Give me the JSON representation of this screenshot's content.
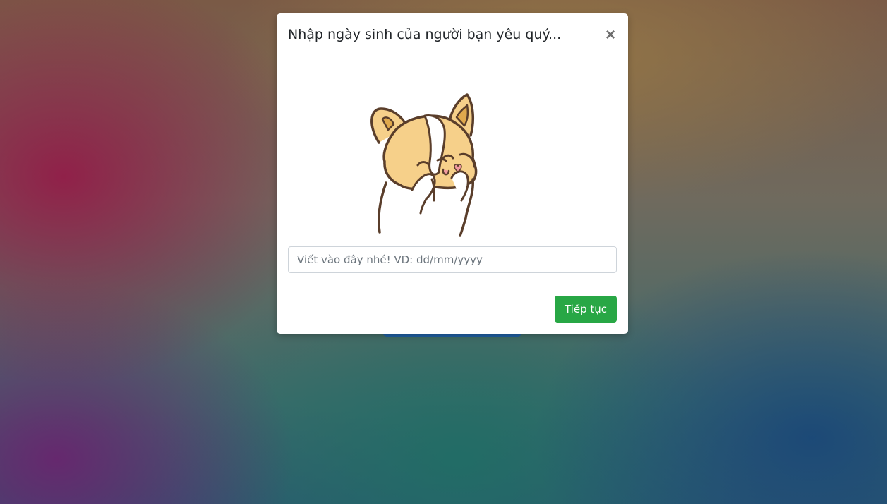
{
  "modal": {
    "title": "Nhập ngày sinh của người bạn yêu quý...",
    "close_label": "×",
    "illustration": "corgi-covering-face-sticker",
    "input": {
      "value": "",
      "placeholder": "Viết vào đây nhé! VD: dd/mm/yyyy"
    },
    "continue_label": "Tiếp tục"
  },
  "colors": {
    "accent_green": "#28a745",
    "background_button_blue": "#1f5fa3",
    "corgi_fur": "#f6d08a",
    "outline": "#5a3e2b"
  }
}
